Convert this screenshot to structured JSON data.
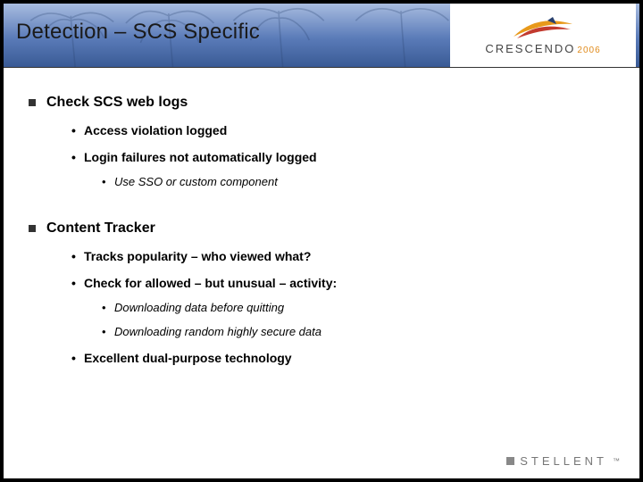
{
  "header": {
    "title": "Detection – SCS Specific",
    "brand": "CRESCENDO",
    "year": "2006"
  },
  "blocks": [
    {
      "title": "Check SCS web logs",
      "items": [
        {
          "text": "Access violation logged",
          "sub": []
        },
        {
          "text": "Login failures not automatically logged",
          "sub": [
            "Use SSO or custom component"
          ]
        }
      ]
    },
    {
      "title": "Content Tracker",
      "items": [
        {
          "text": "Tracks popularity – who viewed what?",
          "sub": []
        },
        {
          "text": "Check for allowed – but unusual – activity:",
          "sub": [
            "Downloading data before quitting",
            "Downloading random highly secure data"
          ]
        },
        {
          "text": "Excellent dual-purpose technology",
          "sub": []
        }
      ]
    }
  ],
  "footer": {
    "brand": "STELLENT"
  }
}
